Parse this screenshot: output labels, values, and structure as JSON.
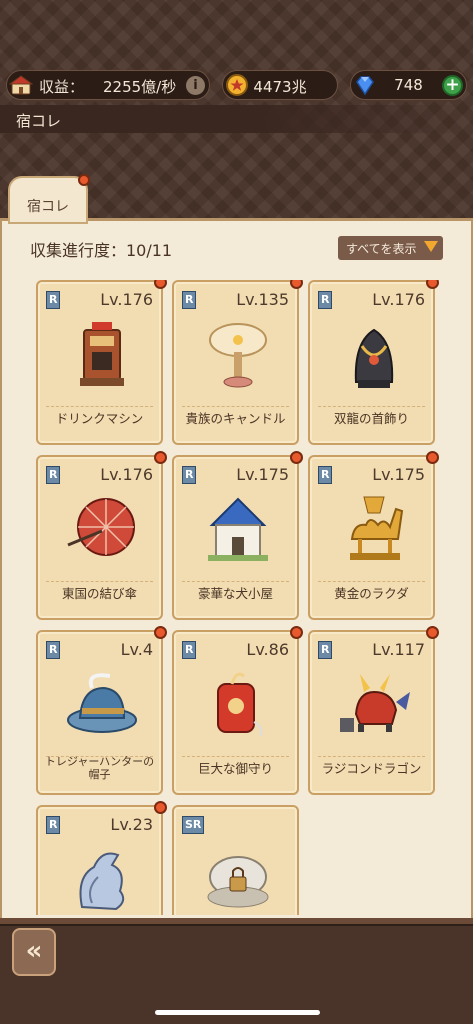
{
  "header": {
    "income_label": "収益：",
    "income_value": "2255億/秒",
    "coins": "4473兆",
    "gems": "748",
    "info_symbol": "i",
    "plus_symbol": "+"
  },
  "screen_title": "宿コレ",
  "tab_label": "宿コレ",
  "progress_text": "収集進行度：10/11",
  "show_all_label": "すべてを表示",
  "items": [
    {
      "rank": "R",
      "level": "Lv.176",
      "name": "ドリンクマシン",
      "icon": "drink-machine-icon",
      "badge": true
    },
    {
      "rank": "R",
      "level": "Lv.135",
      "name": "貴族のキャンドル",
      "icon": "candle-icon",
      "badge": true
    },
    {
      "rank": "R",
      "level": "Lv.176",
      "name": "双龍の首飾り",
      "icon": "necklace-icon",
      "badge": true
    },
    {
      "rank": "R",
      "level": "Lv.176",
      "name": "東国の結び傘",
      "icon": "umbrella-icon",
      "badge": true
    },
    {
      "rank": "R",
      "level": "Lv.175",
      "name": "豪華な犬小屋",
      "icon": "doghouse-icon",
      "badge": true
    },
    {
      "rank": "R",
      "level": "Lv.175",
      "name": "黄金のラクダ",
      "icon": "camel-icon",
      "badge": true
    },
    {
      "rank": "R",
      "level": "Lv.4",
      "name": "トレジャーハンターの帽子",
      "icon": "hat-icon",
      "badge": true
    },
    {
      "rank": "R",
      "level": "Lv.86",
      "name": "巨大な御守り",
      "icon": "charm-icon",
      "badge": true
    },
    {
      "rank": "R",
      "level": "Lv.117",
      "name": "ラジコンドラゴン",
      "icon": "rc-dragon-icon",
      "badge": true
    },
    {
      "rank": "R",
      "level": "Lv.23",
      "name": "",
      "icon": "dragon-statue-icon",
      "badge": true
    },
    {
      "rank": "SR",
      "level": "",
      "name": "",
      "icon": "locked-pearl-icon",
      "badge": false
    }
  ],
  "back_symbol": "«",
  "colors": {
    "badge": "#e85a2e",
    "card": "#f2dcb1",
    "panel": "#f3ead8",
    "bg": "#4a342a"
  }
}
